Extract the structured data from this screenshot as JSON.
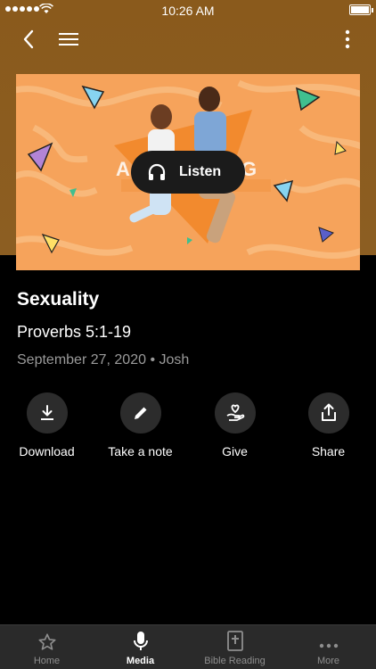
{
  "status_bar": {
    "time": "10:26 AM"
  },
  "hero": {
    "listen_label": "Listen",
    "colors": {
      "background": "#f6a35b",
      "stripe": "#f9b979",
      "banner": "#f07f2a"
    }
  },
  "sermon": {
    "title": "Sexuality",
    "passage": "Proverbs 5:1-19",
    "date": "September 27, 2020",
    "separator": "•",
    "speaker": "Josh"
  },
  "actions": [
    {
      "label": "Download",
      "icon": "download-icon"
    },
    {
      "label": "Take a note",
      "icon": "pencil-icon"
    },
    {
      "label": "Give",
      "icon": "give-hand-heart-icon"
    },
    {
      "label": "Share",
      "icon": "share-icon"
    }
  ],
  "tabs": [
    {
      "label": "Home",
      "icon": "star-icon",
      "active": false
    },
    {
      "label": "Media",
      "icon": "microphone-icon",
      "active": true
    },
    {
      "label": "Bible Reading",
      "icon": "bible-icon",
      "active": false
    },
    {
      "label": "More",
      "icon": "more-dots-icon",
      "active": false
    }
  ],
  "colors": {
    "header": "#8a5a1c",
    "background": "#000000",
    "tabbar": "#2a2a2a",
    "action_circle": "#2c2c2c",
    "muted_text": "#9a9a9a"
  }
}
